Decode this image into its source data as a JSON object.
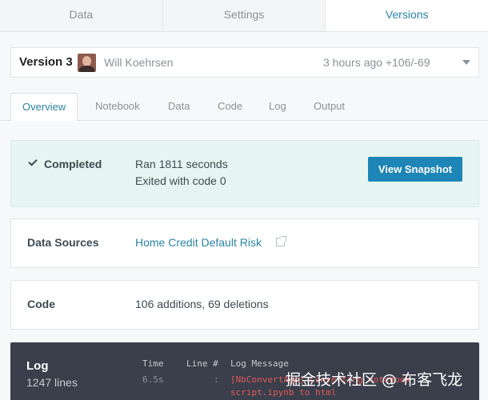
{
  "top_tabs": {
    "data": "Data",
    "settings": "Settings",
    "versions": "Versions"
  },
  "version": {
    "label": "Version 3",
    "author": "Will Koehrsen",
    "meta": "3 hours ago +106/-69"
  },
  "sub_tabs": {
    "overview": "Overview",
    "notebook": "Notebook",
    "data": "Data",
    "code": "Code",
    "log": "Log",
    "output": "Output"
  },
  "status": {
    "label": "Completed",
    "ran": "Ran 1811 seconds",
    "exited": "Exited with code 0",
    "button": "View Snapshot"
  },
  "data_sources": {
    "label": "Data Sources",
    "link": "Home Credit Default Risk"
  },
  "code": {
    "label": "Code",
    "value_additions": "106 additions",
    "value_sep": ", ",
    "value_deletions": "69 deletions"
  },
  "log": {
    "title": "Log",
    "count": "1247 lines",
    "headers": {
      "time": "Time",
      "line": "Line #",
      "message": "Log Message"
    },
    "rows": [
      {
        "time": "6.5s",
        "line": ":",
        "message": "[NbConvertApp] Converting notebook"
      },
      {
        "time": "",
        "line": "",
        "message": "script.ipynb to html"
      }
    ]
  },
  "watermark": "掘金技术社区 @ 布客飞龙",
  "colors": {
    "accent": "#2a84a6",
    "button": "#1e86b6",
    "status_bg": "#e6f5f1",
    "log_bg": "#3a3f4b",
    "log_error": "#e05a5a"
  }
}
